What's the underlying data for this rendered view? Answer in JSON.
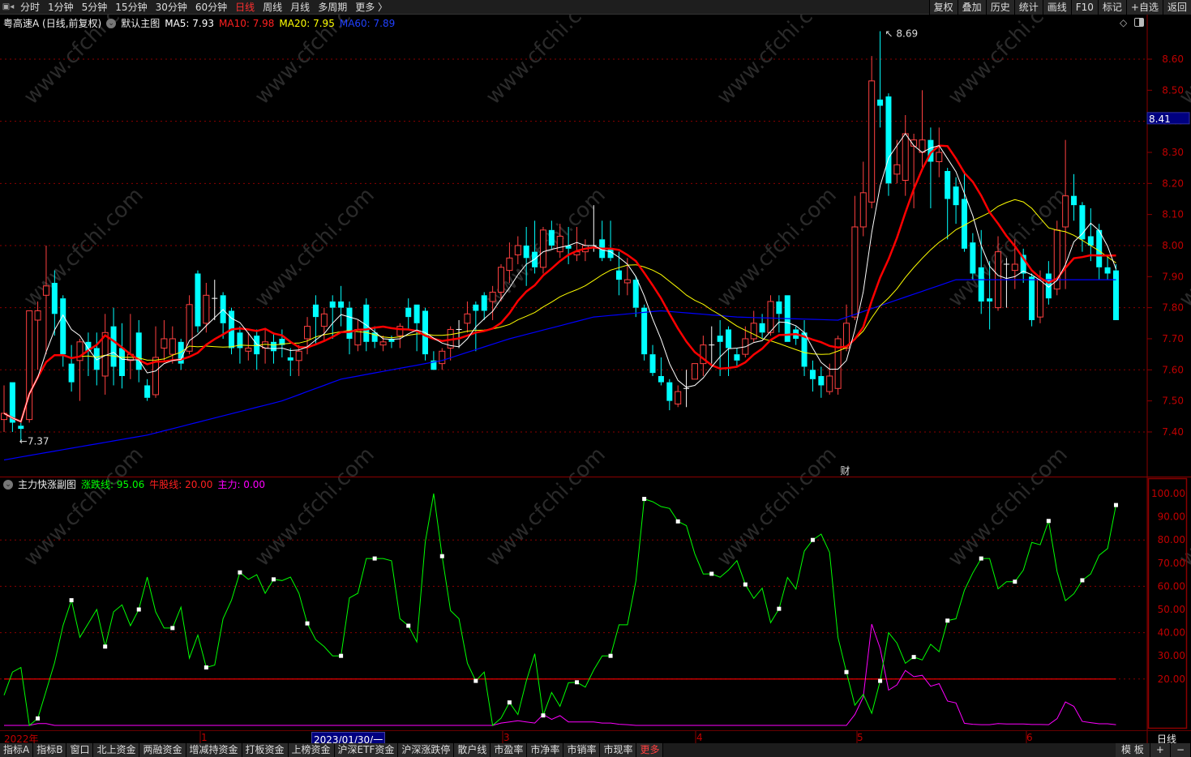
{
  "topbar": {
    "tabs": [
      "分时",
      "1分钟",
      "5分钟",
      "15分钟",
      "30分钟",
      "60分钟",
      "日线",
      "周线",
      "月线",
      "多周期",
      "更多 〉"
    ],
    "active_tab": "日线",
    "right_buttons": [
      "复权",
      "叠加",
      "历史",
      "统计",
      "画线",
      "F10",
      "标记",
      "+自选",
      "返回"
    ]
  },
  "main_legend": {
    "stock": "粤高速A (日线,前复权)",
    "template": "默认主图",
    "ma5": "MA5: 7.93",
    "ma10": "MA10: 7.98",
    "ma20": "MA20: 7.95",
    "ma60": "MA60: 7.89"
  },
  "sub_legend": {
    "title": "主力快涨副图",
    "line1": "涨跌线: 95.06",
    "line2": "牛股线: 20.00",
    "line3": "主力: 0.00"
  },
  "colors": {
    "up": "#ff4040",
    "down": "#00ffff",
    "ma5": "#ffffff",
    "ma10": "#ff0000",
    "ma20": "#ffff00",
    "ma60": "#0000ff",
    "green": "#00ff00",
    "magenta": "#ff00ff",
    "axis": "#c00000",
    "grid": "#8b0000"
  },
  "annotations": {
    "high": "8.69",
    "low": "7.37",
    "current_price": "8.41",
    "event_marker": "财"
  },
  "date_axis": {
    "labels": [
      "2022年",
      "1",
      "3",
      "4",
      "5",
      "6"
    ],
    "selected": "2023/01/30/一",
    "period": "日线"
  },
  "bottombar": {
    "buttons": [
      "指标A",
      "指标B",
      "窗口",
      "北上资金",
      "两融资金",
      "增减持资金",
      "打板资金",
      "上榜资金",
      "沪深ETF资金",
      "沪深涨跌停",
      "散户线",
      "市盈率",
      "市净率",
      "市销率",
      "市现率",
      "更多"
    ],
    "right": [
      "模 板",
      "+",
      "−"
    ]
  },
  "watermark": "www.cfchi.com",
  "chart_data": [
    {
      "type": "candlestick",
      "title": "粤高速A (日线,前复权)",
      "ylim": [
        7.3,
        8.75
      ],
      "yticks": [
        "8.60",
        "8.50",
        "8.40",
        "8.30",
        "8.20",
        "8.10",
        "8.00",
        "7.90",
        "7.80",
        "7.70",
        "7.60",
        "7.50",
        "7.40"
      ],
      "grid_dotted": [
        8.6,
        8.4,
        8.2,
        8.0,
        7.8,
        7.6,
        7.4
      ],
      "ohlc": [
        [
          7.44,
          7.55,
          7.4,
          7.46
        ],
        [
          7.56,
          7.56,
          7.4,
          7.43
        ],
        [
          7.42,
          7.43,
          7.37,
          7.41
        ],
        [
          7.44,
          7.79,
          7.43,
          7.79
        ],
        [
          7.76,
          7.82,
          7.6,
          7.79
        ],
        [
          7.84,
          8.0,
          7.65,
          7.87
        ],
        [
          7.88,
          7.92,
          7.71,
          7.78
        ],
        [
          7.83,
          7.84,
          7.61,
          7.65
        ],
        [
          7.62,
          7.68,
          7.53,
          7.56
        ],
        [
          7.63,
          7.7,
          7.5,
          7.69
        ],
        [
          7.69,
          7.72,
          7.58,
          7.66
        ],
        [
          7.67,
          7.72,
          7.55,
          7.6
        ],
        [
          7.58,
          7.78,
          7.52,
          7.72
        ],
        [
          7.74,
          7.8,
          7.55,
          7.61
        ],
        [
          7.67,
          7.75,
          7.54,
          7.58
        ],
        [
          7.63,
          7.78,
          7.57,
          7.65
        ],
        [
          7.72,
          7.76,
          7.56,
          7.6
        ],
        [
          7.55,
          7.57,
          7.5,
          7.51
        ],
        [
          7.52,
          7.74,
          7.51,
          7.64
        ],
        [
          7.67,
          7.76,
          7.63,
          7.7
        ],
        [
          7.65,
          7.74,
          7.62,
          7.7
        ],
        [
          7.69,
          7.7,
          7.6,
          7.62
        ],
        [
          7.66,
          7.84,
          7.65,
          7.81
        ],
        [
          7.91,
          7.92,
          7.72,
          7.74
        ],
        [
          7.75,
          7.88,
          7.72,
          7.84
        ],
        [
          7.83,
          7.89,
          7.76,
          7.83
        ],
        [
          7.84,
          7.85,
          7.7,
          7.75
        ],
        [
          7.79,
          7.8,
          7.65,
          7.67
        ],
        [
          7.72,
          7.74,
          7.62,
          7.67
        ],
        [
          7.66,
          7.72,
          7.63,
          7.67
        ],
        [
          7.71,
          7.73,
          7.6,
          7.65
        ],
        [
          7.67,
          7.73,
          7.62,
          7.69
        ],
        [
          7.69,
          7.72,
          7.62,
          7.66
        ],
        [
          7.7,
          7.73,
          7.64,
          7.68
        ],
        [
          7.64,
          7.67,
          7.58,
          7.63
        ],
        [
          7.63,
          7.68,
          7.58,
          7.66
        ],
        [
          7.7,
          7.77,
          7.65,
          7.74
        ],
        [
          7.81,
          7.84,
          7.68,
          7.77
        ],
        [
          7.74,
          7.8,
          7.69,
          7.78
        ],
        [
          7.82,
          7.84,
          7.7,
          7.8
        ],
        [
          7.82,
          7.87,
          7.74,
          7.8
        ],
        [
          7.8,
          7.82,
          7.65,
          7.7
        ],
        [
          7.68,
          7.76,
          7.66,
          7.73
        ],
        [
          7.81,
          7.83,
          7.66,
          7.69
        ],
        [
          7.72,
          7.74,
          7.67,
          7.69
        ],
        [
          7.68,
          7.71,
          7.66,
          7.69
        ],
        [
          7.7,
          7.71,
          7.67,
          7.69
        ],
        [
          7.71,
          7.75,
          7.67,
          7.74
        ],
        [
          7.8,
          7.83,
          7.73,
          7.77
        ],
        [
          7.81,
          7.81,
          7.66,
          7.75
        ],
        [
          7.79,
          7.8,
          7.63,
          7.65
        ],
        [
          7.63,
          7.66,
          7.6,
          7.6
        ],
        [
          7.62,
          7.67,
          7.6,
          7.66
        ],
        [
          7.67,
          7.74,
          7.63,
          7.73
        ],
        [
          7.73,
          7.76,
          7.67,
          7.73
        ],
        [
          7.75,
          7.82,
          7.72,
          7.78
        ],
        [
          7.81,
          7.82,
          7.66,
          7.79
        ],
        [
          7.84,
          7.85,
          7.76,
          7.79
        ],
        [
          7.82,
          7.87,
          7.76,
          7.85
        ],
        [
          7.85,
          7.94,
          7.82,
          7.93
        ],
        [
          7.92,
          8.01,
          7.88,
          7.96
        ],
        [
          7.97,
          8.03,
          7.94,
          8.0
        ],
        [
          8.0,
          8.06,
          7.87,
          7.96
        ],
        [
          7.98,
          8.08,
          7.91,
          7.93
        ],
        [
          7.93,
          8.06,
          7.91,
          8.05
        ],
        [
          8.05,
          8.08,
          7.99,
          8.0
        ],
        [
          7.98,
          8.07,
          7.96,
          8.03
        ],
        [
          8.0,
          8.06,
          7.94,
          7.99
        ],
        [
          7.97,
          8.06,
          7.95,
          7.98
        ],
        [
          7.98,
          8.02,
          7.95,
          8.0
        ],
        [
          8.0,
          8.13,
          7.98,
          8.0
        ],
        [
          8.02,
          8.08,
          7.95,
          7.96
        ],
        [
          7.99,
          8.08,
          7.95,
          7.96
        ],
        [
          7.92,
          7.98,
          7.84,
          7.89
        ],
        [
          7.88,
          7.96,
          7.84,
          7.89
        ],
        [
          7.89,
          7.9,
          7.77,
          7.8
        ],
        [
          7.8,
          7.81,
          7.63,
          7.65
        ],
        [
          7.65,
          7.68,
          7.58,
          7.59
        ],
        [
          7.58,
          7.64,
          7.55,
          7.56
        ],
        [
          7.56,
          7.57,
          7.47,
          7.5
        ],
        [
          7.49,
          7.55,
          7.48,
          7.53
        ],
        [
          7.54,
          7.6,
          7.48,
          7.54
        ],
        [
          7.57,
          7.62,
          7.57,
          7.62
        ],
        [
          7.62,
          7.71,
          7.58,
          7.68
        ],
        [
          7.68,
          7.74,
          7.62,
          7.68
        ],
        [
          7.71,
          7.76,
          7.58,
          7.69
        ],
        [
          7.73,
          7.74,
          7.58,
          7.67
        ],
        [
          7.65,
          7.67,
          7.61,
          7.63
        ],
        [
          7.65,
          7.74,
          7.64,
          7.7
        ],
        [
          7.7,
          7.79,
          7.69,
          7.75
        ],
        [
          7.75,
          7.78,
          7.7,
          7.72
        ],
        [
          7.72,
          7.84,
          7.71,
          7.82
        ],
        [
          7.82,
          7.84,
          7.72,
          7.78
        ],
        [
          7.84,
          7.84,
          7.69,
          7.69
        ],
        [
          7.73,
          7.74,
          7.68,
          7.7
        ],
        [
          7.72,
          7.76,
          7.58,
          7.61
        ],
        [
          7.6,
          7.63,
          7.53,
          7.57
        ],
        [
          7.58,
          7.61,
          7.51,
          7.55
        ],
        [
          7.53,
          7.62,
          7.52,
          7.58
        ],
        [
          7.54,
          7.71,
          7.52,
          7.7
        ],
        [
          7.67,
          7.81,
          7.66,
          7.75
        ],
        [
          7.77,
          8.16,
          7.76,
          8.06
        ],
        [
          8.06,
          8.27,
          8.03,
          8.17
        ],
        [
          8.14,
          8.61,
          8.12,
          8.53
        ],
        [
          8.47,
          8.69,
          8.38,
          8.45
        ],
        [
          8.48,
          8.49,
          8.16,
          8.2
        ],
        [
          8.23,
          8.34,
          8.2,
          8.26
        ],
        [
          8.21,
          8.42,
          8.16,
          8.36
        ],
        [
          8.32,
          8.36,
          8.12,
          8.34
        ],
        [
          8.3,
          8.5,
          8.25,
          8.34
        ],
        [
          8.34,
          8.38,
          8.12,
          8.27
        ],
        [
          8.27,
          8.38,
          8.22,
          8.3
        ],
        [
          8.24,
          8.25,
          8.02,
          8.15
        ],
        [
          8.19,
          8.22,
          8.07,
          8.13
        ],
        [
          8.15,
          8.24,
          7.98,
          7.99
        ],
        [
          8.01,
          8.04,
          7.89,
          7.91
        ],
        [
          7.93,
          8.05,
          7.78,
          7.82
        ],
        [
          7.83,
          7.95,
          7.73,
          7.82
        ],
        [
          7.8,
          8.03,
          7.79,
          7.98
        ],
        [
          7.94,
          7.96,
          7.8,
          7.94
        ],
        [
          7.92,
          8.02,
          7.86,
          7.94
        ],
        [
          7.97,
          7.99,
          7.88,
          7.91
        ],
        [
          7.9,
          7.91,
          7.74,
          7.76
        ],
        [
          7.77,
          7.92,
          7.75,
          7.89
        ],
        [
          7.91,
          7.95,
          7.81,
          7.83
        ],
        [
          7.86,
          8.08,
          7.84,
          8.05
        ],
        [
          8.06,
          8.34,
          7.86,
          8.16
        ],
        [
          8.16,
          8.23,
          8.08,
          8.13
        ],
        [
          8.13,
          8.14,
          7.98,
          8.02
        ],
        [
          8.03,
          8.12,
          7.95,
          8.0
        ],
        [
          8.05,
          8.07,
          7.89,
          7.93
        ],
        [
          7.93,
          7.97,
          7.89,
          7.91
        ],
        [
          7.92,
          7.94,
          7.76,
          7.76
        ]
      ],
      "ma60_points": [
        [
          0,
          7.31
        ],
        [
          17,
          7.39
        ],
        [
          33,
          7.5
        ],
        [
          40,
          7.57
        ],
        [
          52,
          7.63
        ],
        [
          60,
          7.7
        ],
        [
          70,
          7.77
        ],
        [
          78,
          7.79
        ],
        [
          87,
          7.77
        ],
        [
          99,
          7.76
        ],
        [
          113,
          7.89
        ],
        [
          132,
          7.89
        ]
      ],
      "high_index": 104,
      "low_index": 2,
      "event_index": 101
    },
    {
      "type": "line",
      "title": "主力快涨副图",
      "ylim": [
        0,
        105
      ],
      "yticks": [
        "100.00",
        "90.00",
        "80.00",
        "70.00",
        "60.00",
        "50.00",
        "40.00",
        "30.00",
        "20.00"
      ],
      "grid_dotted": [
        80,
        60,
        40,
        20
      ],
      "reference_line": 20,
      "series": [
        {
          "name": "涨跌线",
          "color": "#00ff00",
          "values": [
            13,
            23,
            25,
            0,
            3,
            15,
            27,
            43,
            54,
            38,
            44,
            50,
            34,
            49,
            52,
            43,
            50,
            64,
            49,
            42,
            42,
            51,
            29,
            39,
            25,
            26,
            46,
            54,
            66,
            63,
            65,
            57,
            63,
            62.5,
            64,
            57,
            44,
            37,
            34,
            30,
            30,
            55,
            57,
            72,
            72,
            72,
            71,
            46,
            43,
            36,
            79,
            100,
            73,
            49.5,
            46,
            26.8,
            19.2,
            23,
            0,
            3.1,
            9.9,
            4.7,
            19.2,
            30.9,
            4.3,
            14.2,
            8.2,
            18.4,
            18.6,
            16.5,
            23.9,
            30,
            30,
            43.4,
            43.4,
            62.3,
            97.7,
            96.5,
            94.4,
            93.6,
            88,
            86.2,
            74,
            65.3,
            65.4,
            63.9,
            67,
            71.1,
            60.8,
            54.8,
            59.2,
            44.3,
            50.3,
            63.8,
            58.8,
            75.2,
            80,
            82.5,
            74.6,
            37.9,
            23,
            8.7,
            13.4,
            5.2,
            19.2,
            40,
            35.5,
            26.8,
            29.5,
            28.2,
            35,
            31.8,
            45.2,
            46,
            58.3,
            65.8,
            72,
            72,
            58.9,
            62,
            62,
            67,
            78.9,
            77.9,
            88.2,
            66.4,
            53.8,
            56.8,
            62.6,
            65.3,
            73.4,
            76.3,
            95.06
          ]
        },
        {
          "name": "主力",
          "color": "#ff00ff",
          "values": [
            0,
            0,
            0,
            0,
            0.8,
            0.8,
            0,
            0,
            0,
            0,
            0,
            0,
            0,
            0,
            0,
            0,
            0,
            0,
            0,
            0,
            0,
            0,
            0,
            0,
            0,
            0,
            0,
            0,
            0,
            0,
            0,
            0,
            0,
            0,
            0,
            0,
            0,
            0,
            0,
            0,
            0,
            0,
            0,
            0,
            0,
            0,
            0,
            0,
            0,
            0,
            0,
            0,
            0,
            0,
            0,
            0,
            0,
            0,
            0,
            1,
            1.5,
            2,
            1.5,
            1,
            4.7,
            2.6,
            4.2,
            1.5,
            1.5,
            1.5,
            1.5,
            1,
            1,
            0.5,
            0.3,
            0,
            0,
            0,
            0,
            0,
            0,
            0,
            0,
            0,
            0,
            0,
            0,
            0,
            0,
            0,
            0,
            0,
            0,
            0,
            0,
            0,
            0,
            0,
            0,
            0,
            0,
            4.7,
            12.3,
            43.7,
            33.2,
            15.2,
            17.5,
            23.7,
            21,
            21.6,
            16.9,
            18,
            10.5,
            9.7,
            0.9,
            0.5,
            0.3,
            0.3,
            0.8,
            0.6,
            0.6,
            0.6,
            0.4,
            0.4,
            0.3,
            2.9,
            10.1,
            8.2,
            1.7,
            1.2,
            0.7,
            0.7,
            0.3
          ]
        },
        {
          "name": "牛股线",
          "color": "#ff0000",
          "value": 20
        }
      ]
    }
  ]
}
